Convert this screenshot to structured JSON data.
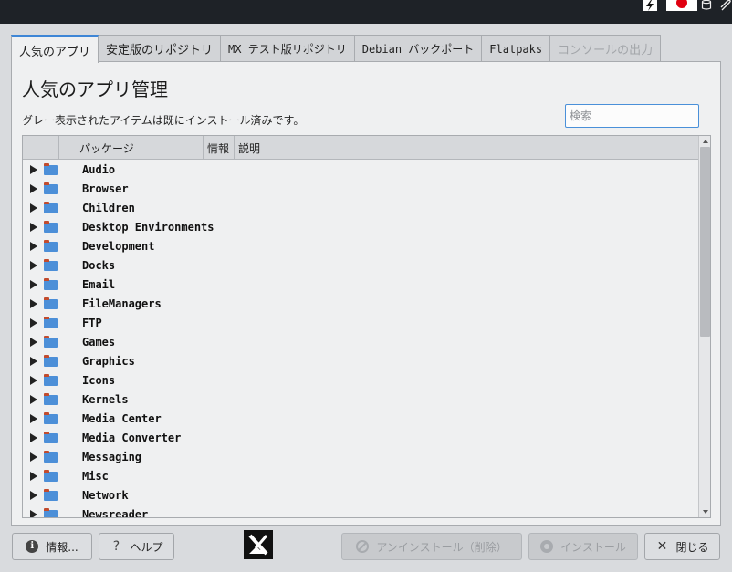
{
  "tray": {
    "bolt_icon": "lightning-icon",
    "flag_icon": "japan-flag-icon",
    "cylinder_icon": "storage-icon",
    "clip_icon": "paperclip-icon"
  },
  "tabs": [
    {
      "label": "人気のアプリ",
      "state": "active"
    },
    {
      "label": "安定版のリポジトリ",
      "state": "normal"
    },
    {
      "label": "MX テスト版リポジトリ",
      "state": "normal"
    },
    {
      "label": "Debian バックポート",
      "state": "normal"
    },
    {
      "label": "Flatpaks",
      "state": "normal"
    },
    {
      "label": "コンソールの出力",
      "state": "disabled"
    }
  ],
  "main": {
    "title": "人気のアプリ管理",
    "subtitle": "グレー表示されたアイテムは既にインストール済みです。",
    "search_placeholder": "検索"
  },
  "tree": {
    "headers": [
      "",
      "パッケージ",
      "情報",
      "説明"
    ],
    "items": [
      "Audio",
      "Browser",
      "Children",
      "Desktop Environments",
      "Development",
      "Docks",
      "Email",
      "FileManagers",
      "FTP",
      "Games",
      "Graphics",
      "Icons",
      "Kernels",
      "Media Center",
      "Media Converter",
      "Messaging",
      "Misc",
      "Network",
      "Newsreader"
    ]
  },
  "buttons": {
    "info": "情報...",
    "help": "ヘルプ",
    "uninstall": "アンインストール（削除）",
    "install": "インストール",
    "close": "閉じる"
  },
  "colors": {
    "accent": "#3e86d6",
    "folder": "#4c8fd8",
    "flag_red": "#e00010"
  }
}
